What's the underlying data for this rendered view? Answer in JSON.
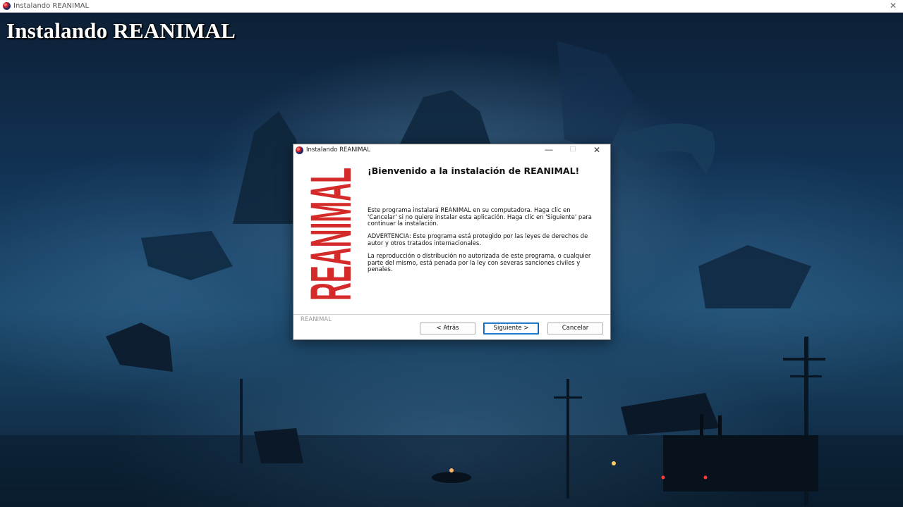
{
  "window": {
    "title": "Instalando REANIMAL",
    "close_glyph": "✕"
  },
  "installer": {
    "heading": "Instalando REANIMAL"
  },
  "dialog": {
    "title": "Instalando REANIMAL",
    "controls": {
      "minimize": "—",
      "maximize": "☐",
      "close": "✕"
    },
    "logo_text": "REANIMAL",
    "logo_color": "#d42a2a",
    "welcome_title": "¡Bienvenido a la instalación de REANIMAL!",
    "paragraphs": [
      "Este programa instalará REANIMAL en su computadora. Haga clic en 'Cancelar' si no quiere instalar esta aplicación. Haga clic en 'Siguiente' para continuar la instalación.",
      "ADVERTENCIA: Este programa está protegido por las leyes de derechos de autor y otros tratados internacionales.",
      "La reproducción o distribución no autorizada de este programa, o cualquier parte del mismo, está penada por la ley con severas sanciones civiles y penales."
    ],
    "brand_label": "REANIMAL",
    "buttons": {
      "back": "< Atrás",
      "next": "Siguiente >",
      "cancel": "Cancelar"
    }
  }
}
